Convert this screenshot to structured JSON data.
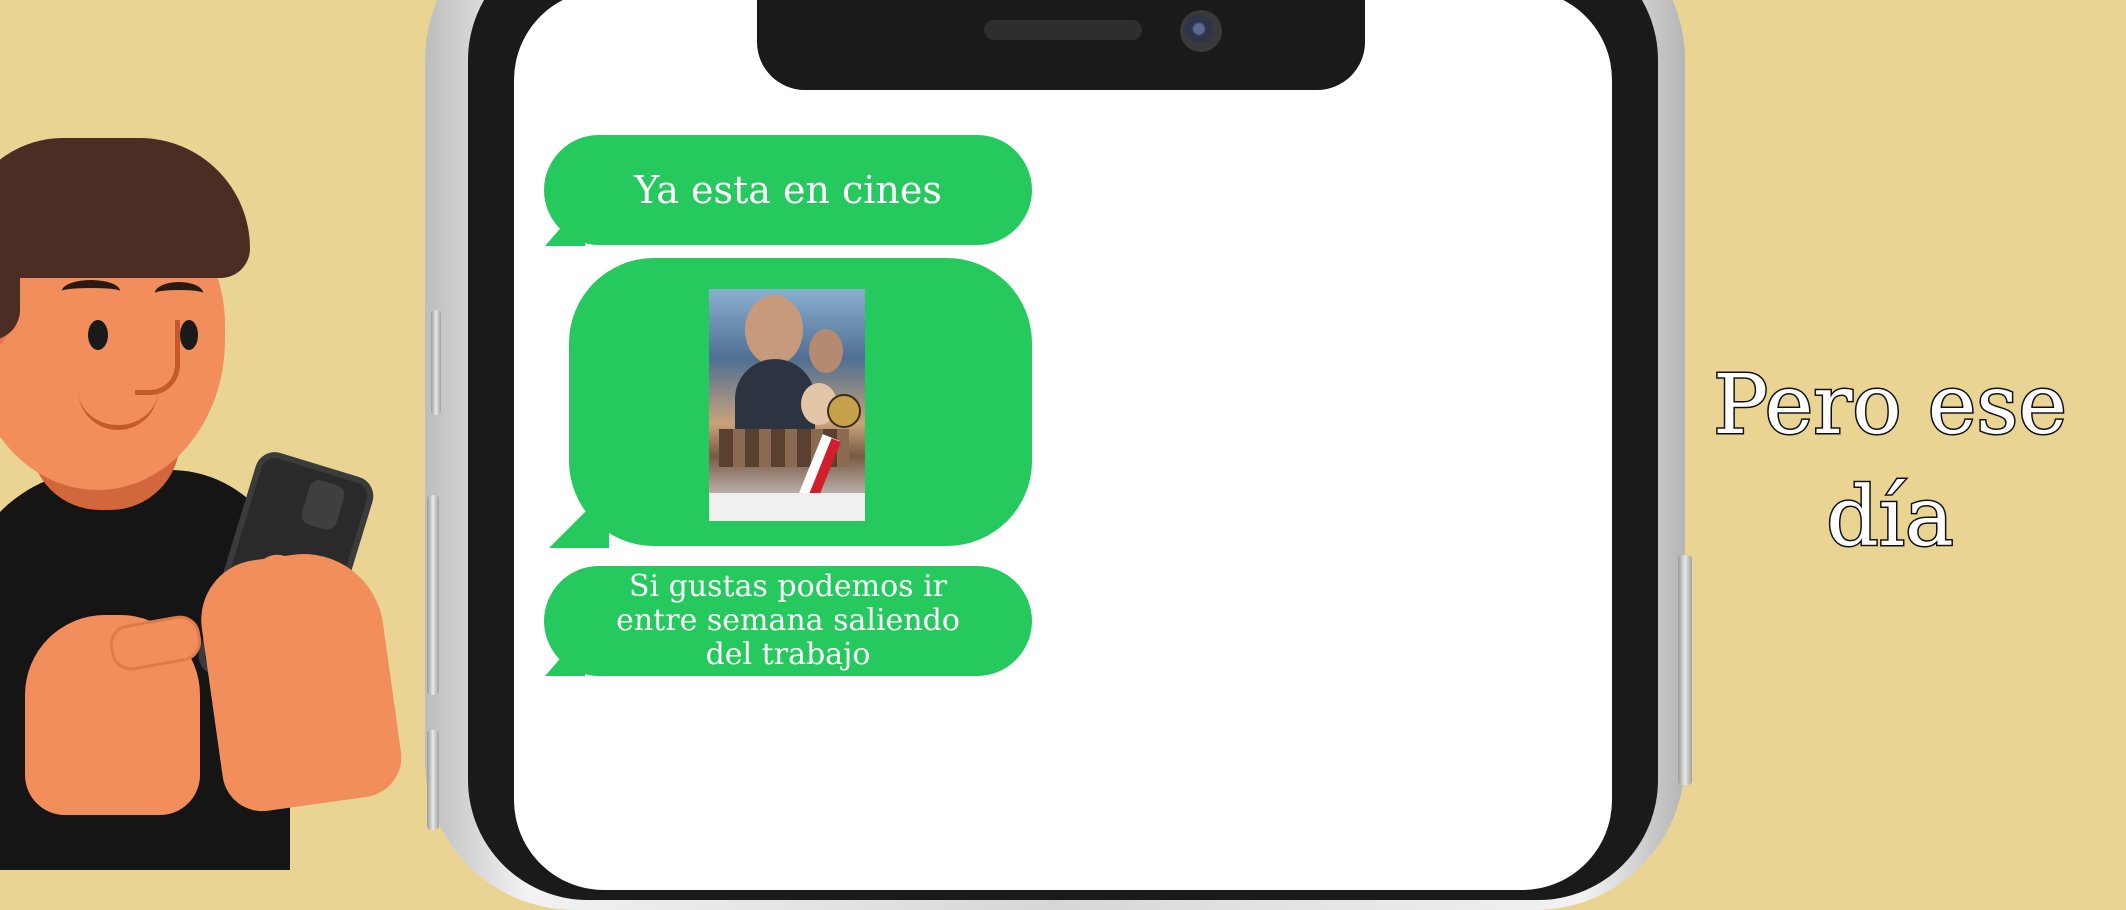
{
  "messages": [
    {
      "text": "Ya esta en cines"
    },
    {
      "image": "movie-poster"
    },
    {
      "text": "Si gustas podemos ir entre semana saliendo del trabajo"
    }
  ],
  "caption": {
    "line1": "Pero ese",
    "line2": "día"
  },
  "colors": {
    "background": "#e9d494",
    "bubble": "#26c95e",
    "skin": "#f28e5b",
    "hair": "#4c2d24",
    "shirt": "#151515"
  }
}
